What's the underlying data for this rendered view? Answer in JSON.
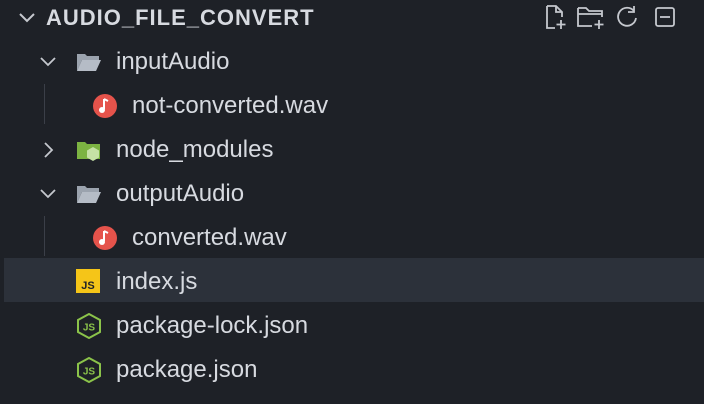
{
  "explorer": {
    "title": "AUDIO_FILE_CONVERT",
    "actions": [
      {
        "icon": "new-file-icon"
      },
      {
        "icon": "new-folder-icon"
      },
      {
        "icon": "refresh-icon"
      },
      {
        "icon": "collapse-all-icon"
      }
    ],
    "items": [
      {
        "label": "inputAudio",
        "type": "folder",
        "expanded": true,
        "icon": "folder-open-icon"
      },
      {
        "label": "not-converted.wav",
        "type": "file",
        "icon": "audio-file-icon"
      },
      {
        "label": "node_modules",
        "type": "folder",
        "expanded": false,
        "icon": "node-folder-icon"
      },
      {
        "label": "outputAudio",
        "type": "folder",
        "expanded": true,
        "icon": "folder-open-icon"
      },
      {
        "label": "converted.wav",
        "type": "file",
        "icon": "audio-file-icon"
      },
      {
        "label": "index.js",
        "type": "file",
        "icon": "js-file-icon",
        "selected": true
      },
      {
        "label": "package-lock.json",
        "type": "file",
        "icon": "nodejs-file-icon"
      },
      {
        "label": "package.json",
        "type": "file",
        "icon": "nodejs-file-icon"
      }
    ]
  },
  "colors": {
    "background": "#1e2127",
    "selected_row": "#2c313a",
    "text": "#d7dae0",
    "audio_icon": "#e5534b",
    "node_folder": "#8bc34a",
    "js_icon": "#f5c518",
    "nodejs_icon": "#8bc34a"
  }
}
